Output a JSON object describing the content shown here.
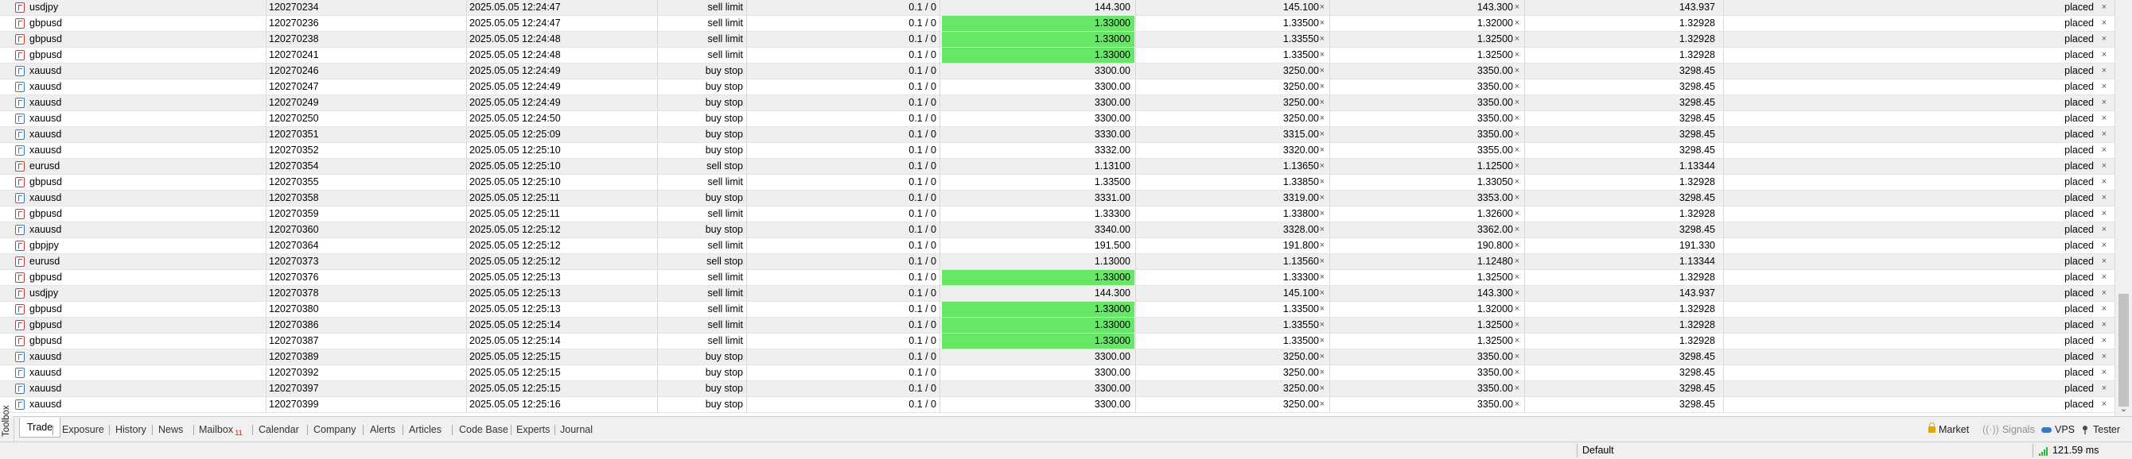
{
  "orders": [
    {
      "symbol": "usdjpy",
      "ticket": "120270234",
      "time": "2025.05.05 12:24:47",
      "type": "sell limit",
      "volume": "0.1 / 0",
      "price": "144.300",
      "highlight": false,
      "sl": "145.100",
      "tp": "143.300",
      "current": "143.937",
      "state": "placed"
    },
    {
      "symbol": "gbpusd",
      "ticket": "120270236",
      "time": "2025.05.05 12:24:47",
      "type": "sell limit",
      "volume": "0.1 / 0",
      "price": "1.33000",
      "highlight": true,
      "sl": "1.33500",
      "tp": "1.32000",
      "current": "1.32928",
      "state": "placed"
    },
    {
      "symbol": "gbpusd",
      "ticket": "120270238",
      "time": "2025.05.05 12:24:48",
      "type": "sell limit",
      "volume": "0.1 / 0",
      "price": "1.33000",
      "highlight": true,
      "sl": "1.33550",
      "tp": "1.32500",
      "current": "1.32928",
      "state": "placed"
    },
    {
      "symbol": "gbpusd",
      "ticket": "120270241",
      "time": "2025.05.05 12:24:48",
      "type": "sell limit",
      "volume": "0.1 / 0",
      "price": "1.33000",
      "highlight": true,
      "sl": "1.33500",
      "tp": "1.32500",
      "current": "1.32928",
      "state": "placed"
    },
    {
      "symbol": "xauusd",
      "ticket": "120270246",
      "time": "2025.05.05 12:24:49",
      "type": "buy stop",
      "volume": "0.1 / 0",
      "price": "3300.00",
      "highlight": false,
      "sl": "3250.00",
      "tp": "3350.00",
      "current": "3298.45",
      "state": "placed"
    },
    {
      "symbol": "xauusd",
      "ticket": "120270247",
      "time": "2025.05.05 12:24:49",
      "type": "buy stop",
      "volume": "0.1 / 0",
      "price": "3300.00",
      "highlight": false,
      "sl": "3250.00",
      "tp": "3350.00",
      "current": "3298.45",
      "state": "placed"
    },
    {
      "symbol": "xauusd",
      "ticket": "120270249",
      "time": "2025.05.05 12:24:49",
      "type": "buy stop",
      "volume": "0.1 / 0",
      "price": "3300.00",
      "highlight": false,
      "sl": "3250.00",
      "tp": "3350.00",
      "current": "3298.45",
      "state": "placed"
    },
    {
      "symbol": "xauusd",
      "ticket": "120270250",
      "time": "2025.05.05 12:24:50",
      "type": "buy stop",
      "volume": "0.1 / 0",
      "price": "3300.00",
      "highlight": false,
      "sl": "3250.00",
      "tp": "3350.00",
      "current": "3298.45",
      "state": "placed"
    },
    {
      "symbol": "xauusd",
      "ticket": "120270351",
      "time": "2025.05.05 12:25:09",
      "type": "buy stop",
      "volume": "0.1 / 0",
      "price": "3330.00",
      "highlight": false,
      "sl": "3315.00",
      "tp": "3350.00",
      "current": "3298.45",
      "state": "placed"
    },
    {
      "symbol": "xauusd",
      "ticket": "120270352",
      "time": "2025.05.05 12:25:10",
      "type": "buy stop",
      "volume": "0.1 / 0",
      "price": "3332.00",
      "highlight": false,
      "sl": "3320.00",
      "tp": "3355.00",
      "current": "3298.45",
      "state": "placed"
    },
    {
      "symbol": "eurusd",
      "ticket": "120270354",
      "time": "2025.05.05 12:25:10",
      "type": "sell stop",
      "volume": "0.1 / 0",
      "price": "1.13100",
      "highlight": false,
      "sl": "1.13650",
      "tp": "1.12500",
      "current": "1.13344",
      "state": "placed"
    },
    {
      "symbol": "gbpusd",
      "ticket": "120270355",
      "time": "2025.05.05 12:25:10",
      "type": "sell limit",
      "volume": "0.1 / 0",
      "price": "1.33500",
      "highlight": false,
      "sl": "1.33850",
      "tp": "1.33050",
      "current": "1.32928",
      "state": "placed"
    },
    {
      "symbol": "xauusd",
      "ticket": "120270358",
      "time": "2025.05.05 12:25:11",
      "type": "buy stop",
      "volume": "0.1 / 0",
      "price": "3331.00",
      "highlight": false,
      "sl": "3319.00",
      "tp": "3353.00",
      "current": "3298.45",
      "state": "placed"
    },
    {
      "symbol": "gbpusd",
      "ticket": "120270359",
      "time": "2025.05.05 12:25:11",
      "type": "sell limit",
      "volume": "0.1 / 0",
      "price": "1.33300",
      "highlight": false,
      "sl": "1.33800",
      "tp": "1.32600",
      "current": "1.32928",
      "state": "placed"
    },
    {
      "symbol": "xauusd",
      "ticket": "120270360",
      "time": "2025.05.05 12:25:12",
      "type": "buy stop",
      "volume": "0.1 / 0",
      "price": "3340.00",
      "highlight": false,
      "sl": "3328.00",
      "tp": "3362.00",
      "current": "3298.45",
      "state": "placed"
    },
    {
      "symbol": "gbpjpy",
      "ticket": "120270364",
      "time": "2025.05.05 12:25:12",
      "type": "sell limit",
      "volume": "0.1 / 0",
      "price": "191.500",
      "highlight": false,
      "sl": "191.800",
      "tp": "190.800",
      "current": "191.330",
      "state": "placed"
    },
    {
      "symbol": "eurusd",
      "ticket": "120270373",
      "time": "2025.05.05 12:25:12",
      "type": "sell stop",
      "volume": "0.1 / 0",
      "price": "1.13000",
      "highlight": false,
      "sl": "1.13560",
      "tp": "1.12480",
      "current": "1.13344",
      "state": "placed"
    },
    {
      "symbol": "gbpusd",
      "ticket": "120270376",
      "time": "2025.05.05 12:25:13",
      "type": "sell limit",
      "volume": "0.1 / 0",
      "price": "1.33000",
      "highlight": true,
      "sl": "1.33300",
      "tp": "1.32500",
      "current": "1.32928",
      "state": "placed"
    },
    {
      "symbol": "usdjpy",
      "ticket": "120270378",
      "time": "2025.05.05 12:25:13",
      "type": "sell limit",
      "volume": "0.1 / 0",
      "price": "144.300",
      "highlight": false,
      "sl": "145.100",
      "tp": "143.300",
      "current": "143.937",
      "state": "placed"
    },
    {
      "symbol": "gbpusd",
      "ticket": "120270380",
      "time": "2025.05.05 12:25:13",
      "type": "sell limit",
      "volume": "0.1 / 0",
      "price": "1.33000",
      "highlight": true,
      "sl": "1.33500",
      "tp": "1.32000",
      "current": "1.32928",
      "state": "placed"
    },
    {
      "symbol": "gbpusd",
      "ticket": "120270386",
      "time": "2025.05.05 12:25:14",
      "type": "sell limit",
      "volume": "0.1 / 0",
      "price": "1.33000",
      "highlight": true,
      "sl": "1.33550",
      "tp": "1.32500",
      "current": "1.32928",
      "state": "placed"
    },
    {
      "symbol": "gbpusd",
      "ticket": "120270387",
      "time": "2025.05.05 12:25:14",
      "type": "sell limit",
      "volume": "0.1 / 0",
      "price": "1.33000",
      "highlight": true,
      "sl": "1.33500",
      "tp": "1.32500",
      "current": "1.32928",
      "state": "placed"
    },
    {
      "symbol": "xauusd",
      "ticket": "120270389",
      "time": "2025.05.05 12:25:15",
      "type": "buy stop",
      "volume": "0.1 / 0",
      "price": "3300.00",
      "highlight": false,
      "sl": "3250.00",
      "tp": "3350.00",
      "current": "3298.45",
      "state": "placed"
    },
    {
      "symbol": "xauusd",
      "ticket": "120270392",
      "time": "2025.05.05 12:25:15",
      "type": "buy stop",
      "volume": "0.1 / 0",
      "price": "3300.00",
      "highlight": false,
      "sl": "3250.00",
      "tp": "3350.00",
      "current": "3298.45",
      "state": "placed"
    },
    {
      "symbol": "xauusd",
      "ticket": "120270397",
      "time": "2025.05.05 12:25:15",
      "type": "buy stop",
      "volume": "0.1 / 0",
      "price": "3300.00",
      "highlight": false,
      "sl": "3250.00",
      "tp": "3350.00",
      "current": "3298.45",
      "state": "placed"
    },
    {
      "symbol": "xauusd",
      "ticket": "120270399",
      "time": "2025.05.05 12:25:16",
      "type": "buy stop",
      "volume": "0.1 / 0",
      "price": "3300.00",
      "highlight": false,
      "sl": "3250.00",
      "tp": "3350.00",
      "current": "3298.45",
      "state": "placed"
    }
  ],
  "close_glyph": "×",
  "highlight_color": "#66e866",
  "toolbox_label": "Toolbox",
  "tabs": [
    {
      "id": "trade",
      "label": "Trade",
      "active": true
    },
    {
      "id": "exposure",
      "label": "Exposure"
    },
    {
      "id": "history",
      "label": "History"
    },
    {
      "id": "news",
      "label": "News"
    },
    {
      "id": "mailbox",
      "label": "Mailbox",
      "badge": "11"
    },
    {
      "id": "calendar",
      "label": "Calendar"
    },
    {
      "id": "company",
      "label": "Company"
    },
    {
      "id": "alerts",
      "label": "Alerts"
    },
    {
      "id": "articles",
      "label": "Articles"
    },
    {
      "id": "code-base",
      "label": "Code Base"
    },
    {
      "id": "experts",
      "label": "Experts"
    },
    {
      "id": "journal",
      "label": "Journal"
    }
  ],
  "right_tabs": [
    {
      "id": "market",
      "label": "Market",
      "icon": "lock-icon"
    },
    {
      "id": "signals",
      "label": "Signals",
      "icon": "signal-icon"
    },
    {
      "id": "vps",
      "label": "VPS",
      "icon": "cloud-icon"
    },
    {
      "id": "tester",
      "label": "Tester",
      "icon": "pin-icon"
    }
  ],
  "status": {
    "profile": "Default",
    "ping": "121.59 ms"
  }
}
